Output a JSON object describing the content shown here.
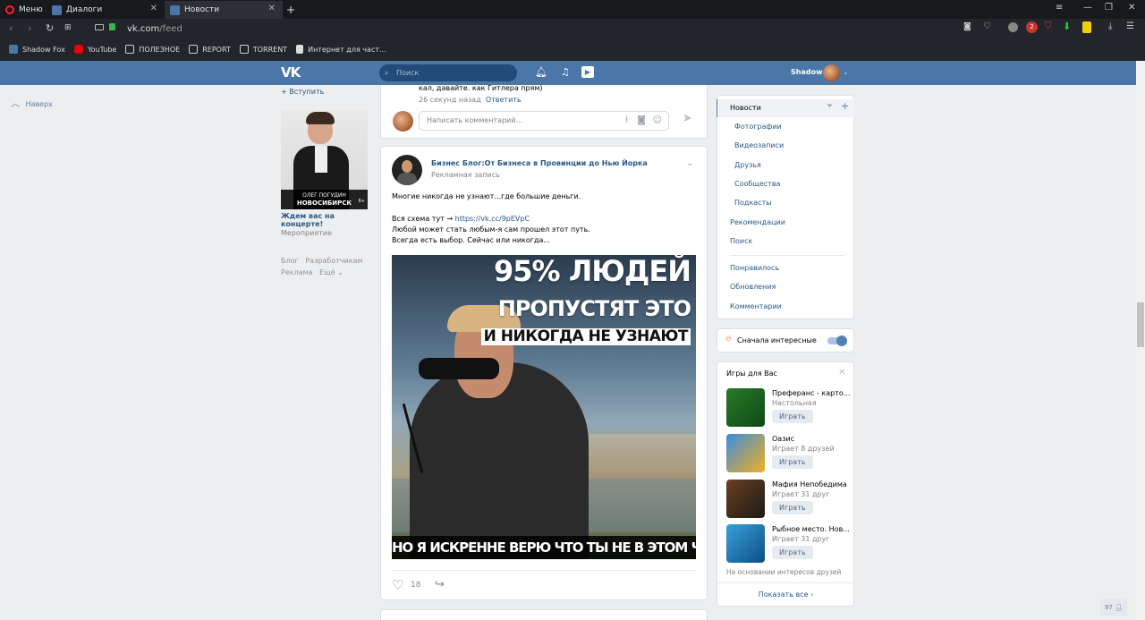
{
  "browser": {
    "menu_label": "Меню",
    "tabs": [
      {
        "label": "Диалоги"
      },
      {
        "label": "Новости"
      }
    ],
    "new_tab": "+",
    "url_host": "vk.com",
    "url_path": "/feed",
    "bookmarks": [
      "Shadow Fox",
      "YouTube",
      "ПОЛЕЗНОЕ",
      "REPORT",
      "TORRENT",
      "Интернет для част..."
    ],
    "badge_count": "2"
  },
  "header": {
    "logo": "VK",
    "search_placeholder": "Поиск",
    "user_name": "Shadow"
  },
  "left": {
    "back_to_top": "Наверх",
    "join": "+ Вступить",
    "ad_banner_line1": "ОЛЕГ ПОГУДИН",
    "ad_banner_line2": "НОВОСИБИРСК",
    "ad_age": "6+",
    "ad_title": "Ждем вас на концерте!",
    "ad_type": "Мероприятие",
    "footer": [
      "Блог",
      "Разработчикам",
      "Реклама",
      "Ещё"
    ]
  },
  "comment_block": {
    "text": "кал, давайте. как Гитлера прям)",
    "time": "26 секунд назад",
    "reply": "Ответить",
    "placeholder": "Написать комментарий..."
  },
  "post": {
    "author": "Бизнес Блог:От Бизнеса в Провинции до Нью Йорка",
    "subtitle": "Рекламная запись",
    "text_line1": "Многие никогда не узнают...где большие деньги.",
    "text_line2_prefix": "Вся схема тут → ",
    "text_link": "https://vk.cc/9pEVpC",
    "text_line3": "Любой может стать любым-я сам прошел этот путь.",
    "text_line4": "Всегда есть выбор. Сейчас или никогда...",
    "image_line1": "95% ЛЮДЕЙ",
    "image_line2": "ПРОПУСТЯТ ЭТО",
    "image_line3": "И НИКОГДА НЕ УЗНАЮТ",
    "image_bottom": "НО Я ИСКРЕННЕ ВЕРЮ ЧТО ТЫ НЕ В ЭТОМ ЧИСЛЕ",
    "likes": "18"
  },
  "right_menu": {
    "items": [
      "Новости",
      "Фотографии",
      "Видеозаписи",
      "Друзья",
      "Сообщества",
      "Подкасты",
      "Рекомендации",
      "Поиск",
      "Понравилось",
      "Обновления",
      "Комментарии"
    ]
  },
  "interesting": {
    "label": "Сначала интересные",
    "enabled": true
  },
  "games": {
    "title": "Игры для Вас",
    "play_label": "Играть",
    "items": [
      {
        "name": "Преферанс - карто...",
        "sub": "Настольная"
      },
      {
        "name": "Оазис",
        "sub": "Играет 8 друзей"
      },
      {
        "name": "Мафия Непобедима",
        "sub": "Играет 31 друг"
      },
      {
        "name": "Рыбное место. Нов...",
        "sub": "Играет 31 друг"
      }
    ],
    "note": "На основании интересов друзей",
    "show_all": "Показать все"
  },
  "online_badge": "97",
  "colors": {
    "vk_blue": "#4a76a8",
    "link": "#2a5885",
    "page_bg": "#edeef0"
  }
}
